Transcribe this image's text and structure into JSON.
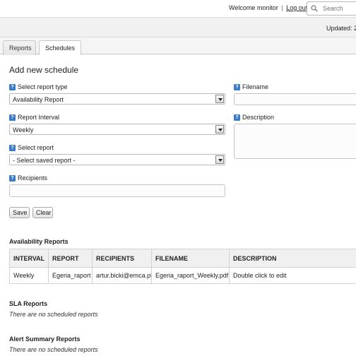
{
  "header": {
    "welcome_text": "Welcome monitor",
    "separator": "|",
    "logout_label": "Log out",
    "search_placeholder": "Search",
    "updated_text": "Updated: 2"
  },
  "tabs": [
    {
      "label": "Reports",
      "active": false
    },
    {
      "label": "Schedules",
      "active": true
    }
  ],
  "form": {
    "heading": "Add new schedule",
    "help_glyph": "?",
    "report_type": {
      "label": "Select report type",
      "value": "Availability Report"
    },
    "interval": {
      "label": "Report Interval",
      "value": "Weekly"
    },
    "saved_report": {
      "label": "Select report",
      "value": "- Select saved report -"
    },
    "recipients": {
      "label": "Recipients",
      "value": ""
    },
    "filename": {
      "label": "Filename",
      "value": ""
    },
    "description": {
      "label": "Description",
      "value": ""
    },
    "save_label": "Save",
    "clear_label": "Clear"
  },
  "availability": {
    "title": "Availability Reports",
    "columns": [
      "INTERVAL",
      "REPORT",
      "RECIPIENTS",
      "FILENAME",
      "DESCRIPTION"
    ],
    "rows": [
      [
        "Weekly",
        "Egeria_raport",
        "artur.bicki@emca.pl",
        "Egeria_raport_Weekly.pdf",
        "Double click to edit"
      ]
    ]
  },
  "sla": {
    "title": "SLA Reports",
    "empty_text": "There are no scheduled reports"
  },
  "alert_summary": {
    "title": "Alert Summary Reports",
    "empty_text": "There are no scheduled reports"
  },
  "colors": {
    "help_icon": "#3a7cc6",
    "header_bg": "#f1f1f1",
    "table_header_bg": "#f0f0f0"
  }
}
